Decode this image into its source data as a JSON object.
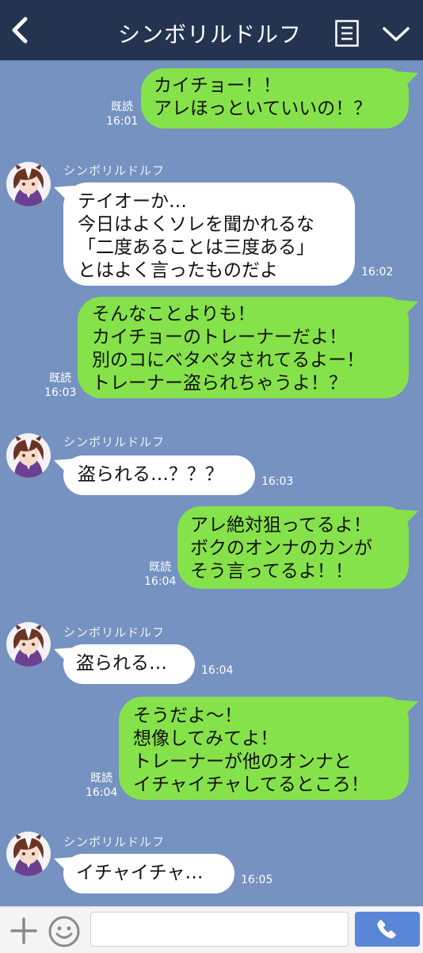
{
  "header": {
    "title": "シンボリルドルフ"
  },
  "sender_name": "シンボリルドルフ",
  "messages": [
    {
      "lines": [
        "カイチョー！！",
        "アレほっといていいの！？"
      ],
      "read": "既読",
      "time": "16:01"
    },
    {
      "lines": [
        "テイオーか…",
        "今日はよくソレを聞かれるな",
        "「二度あることは三度ある」",
        "とはよく言ったものだよ"
      ],
      "time": "16:02"
    },
    {
      "lines": [
        "そんなことよりも！",
        "カイチョーのトレーナーだよ！",
        "別のコにベタベタされてるよー！",
        "トレーナー盗られちゃうよ！？"
      ],
      "read": "既読",
      "time": "16:03"
    },
    {
      "lines": [
        "盗られる…？？？"
      ],
      "time": "16:03"
    },
    {
      "lines": [
        "アレ絶対狙ってるよ！",
        "ボクのオンナのカンが",
        "そう言ってるよ！！"
      ],
      "read": "既読",
      "time": "16:04"
    },
    {
      "lines": [
        "盗られる…"
      ],
      "time": "16:04"
    },
    {
      "lines": [
        "そうだよ～！",
        "想像してみてよ！",
        "トレーナーが他のオンナと",
        "イチャイチャしてるところ！"
      ],
      "read": "既読",
      "time": "16:04"
    },
    {
      "lines": [
        "イチャイチャ…"
      ],
      "time": "16:05"
    }
  ],
  "input": {
    "value": "",
    "placeholder": ""
  },
  "colors": {
    "header": "#243350",
    "background": "#7592c0",
    "outgoing": "#86e24a",
    "incoming": "#ffffff",
    "call": "#5a86d8"
  },
  "icons": [
    "chevron-left-icon",
    "menu-list-icon",
    "chevron-down-icon",
    "plus-icon",
    "emoji-icon",
    "phone-icon"
  ]
}
